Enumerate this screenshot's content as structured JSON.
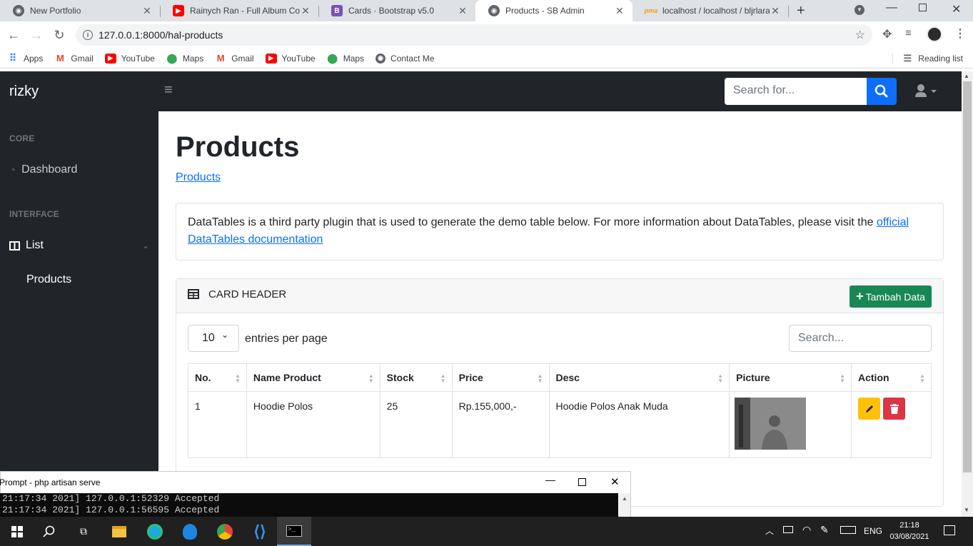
{
  "browser": {
    "tabs": [
      {
        "title": "New Portfolio",
        "icon": "globe-icon",
        "color": "#5f6368"
      },
      {
        "title": "Rainych Ran - Full Album Cov",
        "icon": "youtube-icon",
        "color": "#ff0000"
      },
      {
        "title": "Cards · Bootstrap v5.0",
        "icon": "bootstrap-icon",
        "color": "#7952b3"
      },
      {
        "title": "Products - SB Admin",
        "icon": "globe-icon",
        "color": "#5f6368"
      },
      {
        "title": "localhost / localhost / bljrlara",
        "icon": "phpmyadmin-icon",
        "color": "#f89c0e"
      }
    ],
    "url": "127.0.0.1:8000/hal-products",
    "bookmarks": [
      {
        "label": "Apps",
        "icon": "apps-grid-icon"
      },
      {
        "label": "Gmail",
        "icon": "gmail-icon"
      },
      {
        "label": "YouTube",
        "icon": "youtube-icon"
      },
      {
        "label": "Maps",
        "icon": "maps-pin-icon"
      },
      {
        "label": "Gmail",
        "icon": "gmail-icon"
      },
      {
        "label": "YouTube",
        "icon": "youtube-icon"
      },
      {
        "label": "Maps",
        "icon": "maps-pin-icon"
      },
      {
        "label": "Contact Me",
        "icon": "globe-icon"
      }
    ],
    "reading_list": "Reading list"
  },
  "app": {
    "brand": "rizky",
    "search_placeholder": "Search for...",
    "sidebar": {
      "heading_core": "CORE",
      "dashboard": "Dashboard",
      "heading_interface": "INTERFACE",
      "list": "List",
      "products": "Products"
    },
    "page_title": "Products",
    "breadcrumb": "Products",
    "info_text": "DataTables is a third party plugin that is used to generate the demo table below. For more information about DataTables, please visit the ",
    "info_link": "official DataTables documentation",
    "card_header": "CARD HEADER",
    "add_button": "Tambah Data",
    "entries_value": "10",
    "entries_label": "entries per page",
    "table_search_placeholder": "Search...",
    "table": {
      "columns": [
        "No.",
        "Name Product",
        "Stock",
        "Price",
        "Desc",
        "Picture",
        "Action"
      ],
      "rows": [
        {
          "no": "1",
          "name": "Hoodie Polos",
          "stock": "25",
          "price": "Rp.155,000,-",
          "desc": "Hoodie Polos Anak Muda"
        }
      ]
    }
  },
  "cmd": {
    "title": "Prompt - php  artisan serve",
    "lines": [
      "21:17:34 2021] 127.0.0.1:52329 Accepted",
      "21:17:34 2021] 127.0.0.1:56595 Accepted"
    ]
  },
  "taskbar": {
    "lang": "ENG",
    "time": "21:18",
    "date": "03/08/2021"
  },
  "colors": {
    "dark": "#212529",
    "primary": "#0d6efd",
    "success": "#198754",
    "warning": "#ffc107",
    "danger": "#dc3545"
  }
}
